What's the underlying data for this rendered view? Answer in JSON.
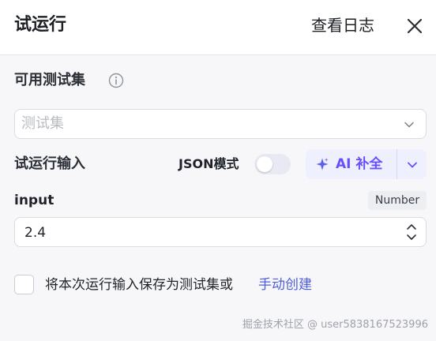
{
  "header": {
    "title": "试运行",
    "view_log_label": "查看日志",
    "close_icon": "close-icon"
  },
  "test_set": {
    "label": "可用测试集",
    "info_icon": "info-icon",
    "placeholder": "测试集",
    "chevron_icon": "chevron-down-icon"
  },
  "run_input": {
    "label": "试运行输入",
    "json_mode_label": "JSON模式",
    "json_mode_on": false,
    "ai_button_label": "AI 补全",
    "ai_icon": "sparkle-icon",
    "ai_dropdown_icon": "chevron-down-icon"
  },
  "field": {
    "name": "input",
    "type": "Number",
    "value": "2.4"
  },
  "footer": {
    "save_text": "将本次运行输入保存为测试集或",
    "create_link": "手动创建",
    "checked": false
  },
  "watermark": "掘金技术社区 @ user5838167523996",
  "colors": {
    "accent": "#6a4cff",
    "link": "#4e5fd8",
    "ai_bg": "#eef0fd",
    "page_bg": "#f7f7f9"
  }
}
